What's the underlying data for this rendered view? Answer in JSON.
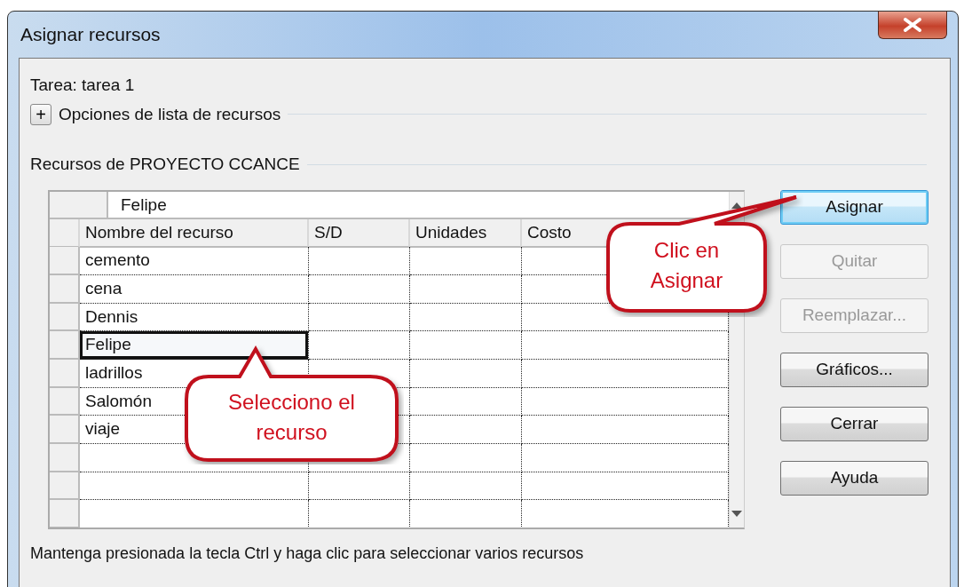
{
  "window": {
    "title": "Asignar recursos"
  },
  "task_label": "Tarea: tarea 1",
  "options": {
    "toggle": "+",
    "label": "Opciones de lista de recursos"
  },
  "resources_group": "Recursos de PROYECTO CCANCE",
  "grid": {
    "edit_value": "Felipe",
    "columns": [
      "Nombre del recurso",
      "S/D",
      "Unidades",
      "Costo"
    ],
    "rows": [
      {
        "name": "cemento",
        "selected": false
      },
      {
        "name": "cena",
        "selected": false
      },
      {
        "name": "Dennis",
        "selected": false
      },
      {
        "name": "Felipe",
        "selected": true
      },
      {
        "name": "ladrillos",
        "selected": false
      },
      {
        "name": "Salomón",
        "selected": false
      },
      {
        "name": "viaje",
        "selected": false
      }
    ]
  },
  "buttons": [
    {
      "label": "Asignar",
      "disabled": false,
      "default": true
    },
    {
      "label": "Quitar",
      "disabled": true,
      "default": false
    },
    {
      "label": "Reemplazar...",
      "disabled": true,
      "default": false
    },
    {
      "label": "Gráficos...",
      "disabled": false,
      "default": false
    },
    {
      "label": "Cerrar",
      "disabled": false,
      "default": false
    },
    {
      "label": "Ayuda",
      "disabled": false,
      "default": false
    }
  ],
  "hint": "Mantenga presionada la tecla Ctrl y haga clic para seleccionar varios recursos",
  "callouts": [
    {
      "text": "Clic en Asignar"
    },
    {
      "text": "Selecciono el recurso"
    }
  ]
}
